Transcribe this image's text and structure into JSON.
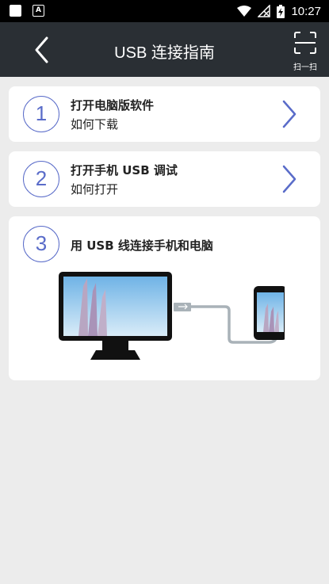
{
  "status_bar": {
    "time": "10:27"
  },
  "header": {
    "title": "USB 连接指南",
    "scan_label": "扫一扫"
  },
  "steps": [
    {
      "number": "1",
      "title": "打开电脑版软件",
      "subtitle": "如何下载"
    },
    {
      "number": "2",
      "title": "打开手机 USB 调试",
      "subtitle": "如何打开"
    },
    {
      "number": "3",
      "title": "用 USB 线连接手机和电脑"
    }
  ],
  "colors": {
    "accent": "#5a6cc9",
    "header_bg": "#2a2f34",
    "page_bg": "#ececec"
  }
}
